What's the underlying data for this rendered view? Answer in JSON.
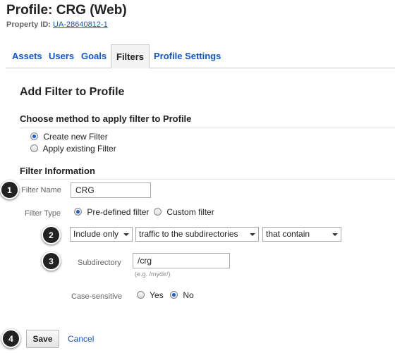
{
  "header": {
    "title": "Profile: CRG (Web)",
    "property_label": "Property ID:",
    "property_id": "UA-28640812-1"
  },
  "tabs": [
    {
      "label": "Assets",
      "active": false
    },
    {
      "label": "Users",
      "active": false
    },
    {
      "label": "Goals",
      "active": false
    },
    {
      "label": "Filters",
      "active": true
    },
    {
      "label": "Profile Settings",
      "active": false
    }
  ],
  "page_heading": "Add Filter to Profile",
  "method": {
    "heading": "Choose method to apply filter to Profile",
    "options": [
      {
        "label": "Create new Filter",
        "selected": true
      },
      {
        "label": "Apply existing Filter",
        "selected": false
      }
    ]
  },
  "filter_info": {
    "heading": "Filter Information",
    "name_label": "Filter Name",
    "name_value": "CRG",
    "type_label": "Filter Type",
    "type_options": [
      {
        "label": "Pre-defined filter",
        "selected": true
      },
      {
        "label": "Custom filter",
        "selected": false
      }
    ],
    "selects": {
      "include": "Include only",
      "traffic": "traffic to the subdirectories",
      "match": "that contain"
    },
    "subdirectory_label": "Subdirectory",
    "subdirectory_value": "/crg",
    "subdirectory_hint": "(e.g. /mydir/)",
    "case_label": "Case-sensitive",
    "case_options": [
      {
        "label": "Yes",
        "selected": false
      },
      {
        "label": "No",
        "selected": true
      }
    ]
  },
  "actions": {
    "save": "Save",
    "cancel": "Cancel"
  },
  "callouts": [
    "1",
    "2",
    "3",
    "4"
  ],
  "colors": {
    "link": "#1155cc",
    "tab_active_bg": "#f3f3f3",
    "radio_selected": "#1d5fc4",
    "badge": "#222222"
  }
}
